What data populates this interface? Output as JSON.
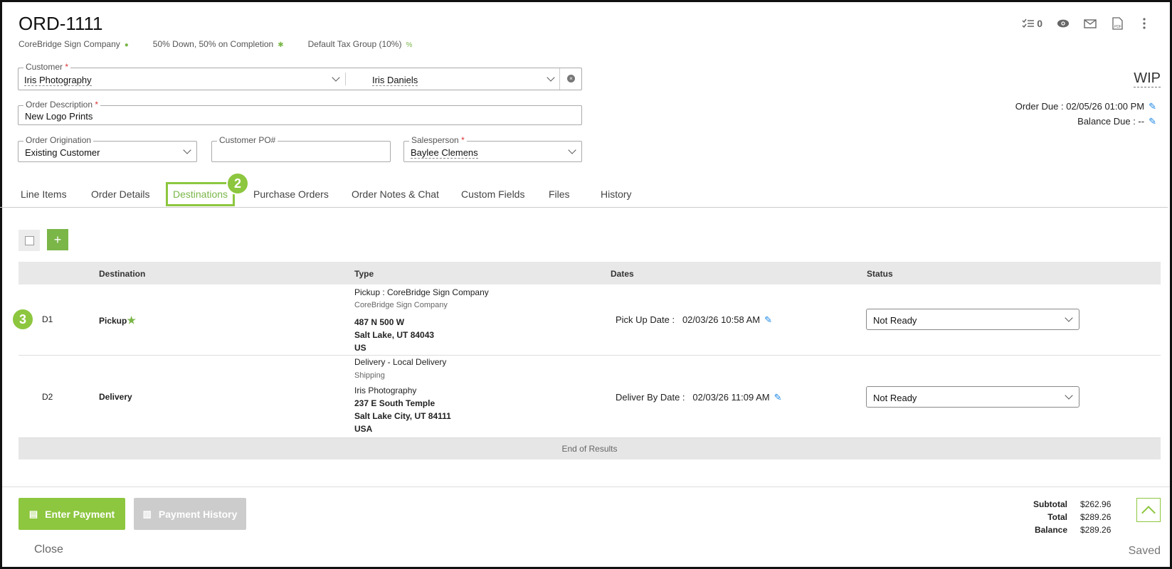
{
  "header": {
    "order_number": "ORD-1111",
    "company": "CoreBridge Sign Company",
    "payment_terms": "50% Down, 50% on Completion",
    "tax_group": "Default Tax Group (10%)",
    "task_count": "0",
    "status": "WIP",
    "order_due": "Order Due : 02/05/26 01:00 PM",
    "balance_due": "Balance Due : --"
  },
  "form": {
    "customer_label": "Customer",
    "customer_value": "Iris Photography",
    "contact_value": "Iris Daniels",
    "description_label": "Order Description",
    "description_value": "New Logo Prints",
    "origination_label": "Order Origination",
    "origination_value": "Existing Customer",
    "po_label": "Customer PO#",
    "po_value": "",
    "salesperson_label": "Salesperson",
    "salesperson_value": "Baylee Clemens",
    "required_mark": "*"
  },
  "tabs": [
    {
      "label": "Line Items"
    },
    {
      "label": "Order Details"
    },
    {
      "label": "Destinations"
    },
    {
      "label": "Purchase Orders"
    },
    {
      "label": "Order Notes & Chat"
    },
    {
      "label": "Custom Fields"
    },
    {
      "label": "Files"
    },
    {
      "label": "History"
    }
  ],
  "callouts": {
    "tab_badge": "2",
    "row_badge": "3"
  },
  "toolbar": {
    "add_label": "+"
  },
  "table": {
    "columns": [
      "Destination",
      "Type",
      "Dates",
      "Status"
    ],
    "rows": [
      {
        "id": "D1",
        "destination": "Pickup",
        "type_title": "Pickup : CoreBridge Sign Company",
        "type_sub": "CoreBridge Sign Company",
        "addr1": "487 N 500 W",
        "addr2": "Salt Lake, UT 84043",
        "addr3": "US",
        "date_label": "Pick Up Date :",
        "date_value": "02/03/26 10:58 AM",
        "status": "Not Ready"
      },
      {
        "id": "D2",
        "destination": "Delivery",
        "type_title": "Delivery - Local Delivery",
        "type_sub": "Shipping",
        "addr0": "Iris Photography",
        "addr1": "237 E South Temple",
        "addr2": "Salt Lake City, UT 84111",
        "addr3": "USA",
        "date_label": "Deliver By Date :",
        "date_value": "02/03/26 11:09 AM",
        "status": "Not Ready"
      }
    ],
    "end_text": "End of Results"
  },
  "footer": {
    "enter_payment": "Enter Payment",
    "payment_history": "Payment History",
    "close": "Close",
    "subtotal_label": "Subtotal",
    "subtotal_value": "$262.96",
    "total_label": "Total",
    "total_value": "$289.26",
    "balance_label": "Balance",
    "balance_value": "$289.26",
    "saved": "Saved"
  },
  "colors": {
    "accent": "#8dc63f",
    "link": "#1e88e5"
  }
}
